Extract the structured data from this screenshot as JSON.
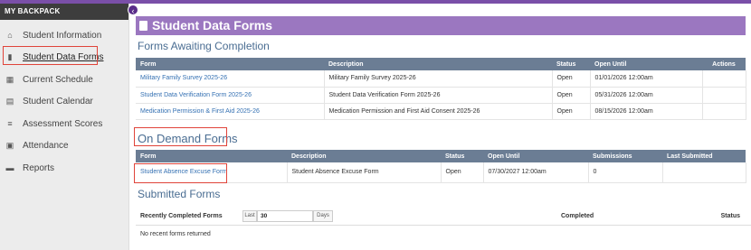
{
  "sidebar": {
    "header": "MY BACKPACK",
    "collapse_glyph": "‹",
    "items": [
      {
        "label": "Student Information",
        "icon": "⌂"
      },
      {
        "label": "Student Data Forms",
        "icon": "▮"
      },
      {
        "label": "Current Schedule",
        "icon": "▦"
      },
      {
        "label": "Student Calendar",
        "icon": "▤"
      },
      {
        "label": "Assessment Scores",
        "icon": "≡"
      },
      {
        "label": "Attendance",
        "icon": "▣"
      },
      {
        "label": "Reports",
        "icon": "▬"
      }
    ]
  },
  "banner": {
    "title": "Student Data Forms"
  },
  "awaiting": {
    "title": "Forms Awaiting Completion",
    "headers": [
      "Form",
      "Description",
      "Status",
      "Open Until",
      "Actions"
    ],
    "rows": [
      {
        "form": "Military Family Survey 2025-26",
        "description": "Military Family Survey 2025-26",
        "status": "Open",
        "open_until": "01/01/2026 12:00am"
      },
      {
        "form": "Student Data Verification Form 2025-26",
        "description": "Student Data Verification Form 2025-26",
        "status": "Open",
        "open_until": "05/31/2026 12:00am"
      },
      {
        "form": "Medication Permission & First Aid 2025-26",
        "description": "Medication Permission and First Aid Consent 2025-26",
        "status": "Open",
        "open_until": "08/15/2026 12:00am"
      }
    ]
  },
  "on_demand": {
    "title": "On Demand Forms",
    "headers": [
      "Form",
      "Description",
      "Status",
      "Open Until",
      "Submissions",
      "Last Submitted"
    ],
    "rows": [
      {
        "form": "Student Absence Excuse Form",
        "description": "Student Absence Excuse Form",
        "status": "Open",
        "open_until": "07/30/2027 12:00am",
        "submissions": "0",
        "last_submitted": ""
      }
    ]
  },
  "submitted": {
    "title": "Submitted Forms",
    "recent_label": "Recently Completed Forms",
    "last_label": "Last",
    "days_value": "30",
    "days_label": "Days",
    "completed_label": "Completed",
    "status_label": "Status",
    "empty_message": "No recent forms returned"
  }
}
